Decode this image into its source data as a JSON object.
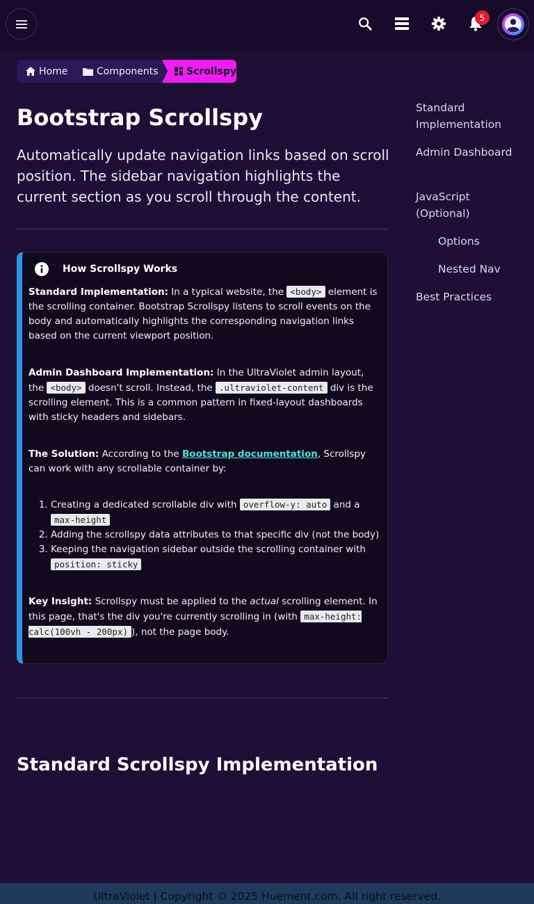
{
  "breadcrumb": {
    "home": "Home",
    "components": "Components",
    "current": "Scrollspy"
  },
  "header": {
    "notification_count": "5"
  },
  "page": {
    "title": "Bootstrap Scrollspy",
    "lead": "Automatically update navigation links based on scroll position. The sidebar navigation highlights the current section as you scroll through the content."
  },
  "card": {
    "title": "How Scrollspy Works",
    "p1_label": "Standard Implementation:",
    "p1_a": " In a typical website, the ",
    "p1_code": "<body>",
    "p1_b": " element is the scrolling container. Bootstrap Scrollspy listens to scroll events on the body and automatically highlights the corresponding navigation links based on the current viewport position.",
    "p2_label": "Admin Dashboard Implementation:",
    "p2_a": " In the UltraViolet admin layout, the ",
    "p2_code1": "<body>",
    "p2_b": " doesn't scroll. Instead, the ",
    "p2_code2": ".ultraviolet-content",
    "p2_c": " div is the scrolling element. This is a common pattern in fixed-layout dashboards with sticky headers and sidebars.",
    "p3_label": "The Solution:",
    "p3_a": " According to the ",
    "p3_link": "Bootstrap documentation",
    "p3_b": ", Scrollspy can work with any scrollable container by:",
    "li1_a": "Creating a dedicated scrollable div with ",
    "li1_code1": "overflow-y: auto",
    "li1_b": " and a ",
    "li1_code2": "max-height",
    "li2": "Adding the scrollspy data attributes to that specific div (not the body)",
    "li3_a": "Keeping the navigation sidebar outside the scrolling container with ",
    "li3_code": "position: sticky",
    "p4_label": "Key Insight:",
    "p4_a": " Scrollspy must be applied to the ",
    "p4_em": "actual",
    "p4_b": " scrolling element. In this page, that's the div you're currently scrolling in (with ",
    "p4_code": "max-height: calc(100vh - 200px)",
    "p4_c": "), not the page body."
  },
  "section": {
    "title": "Standard Scrollspy Implementation"
  },
  "toc": {
    "items": [
      "Standard Implementation",
      "Admin Dashboard",
      "JavaScript (Optional)",
      "Options",
      "Nested Nav",
      "Best Practices"
    ]
  },
  "footer": {
    "text": "UltraViolet | Copyright © 2025 Huement.com. All right reserved."
  },
  "icons": {
    "menu": "hamburger-icon",
    "search": "search-icon",
    "layers": "storage-icon",
    "settings": "gear-icon",
    "notifications": "bell-icon",
    "profile": "user-avatar-icon",
    "home": "home-icon",
    "folder": "folder-icon",
    "dashboard": "dashboard-icon",
    "info": "info-icon"
  },
  "colors": {
    "accent": "#f01cf0",
    "info_border": "#2e94e6",
    "link": "#52e0d6",
    "badge": "#e01d2e"
  }
}
